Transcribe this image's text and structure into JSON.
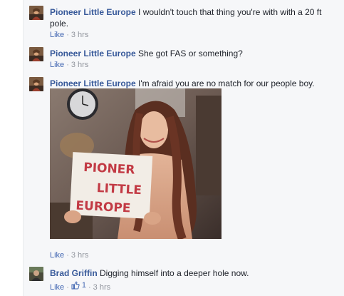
{
  "comments": [
    {
      "author": "Pioneer Little Europe",
      "text": "I wouldn't touch that thing you're with with a 20 ft pole.",
      "like_label": "Like",
      "time": "3 hrs"
    },
    {
      "author": "Pioneer Little Europe",
      "text": "She got FAS or something?",
      "like_label": "Like",
      "time": "3 hrs"
    },
    {
      "author": "Pioneer Little Europe",
      "text": "I'm afraid you are no match for our people boy.",
      "like_label": "Like",
      "time": "3 hrs",
      "photo_sign": {
        "line1": "PIONER",
        "line2": "LITTLE",
        "line3": "EUROPE"
      }
    },
    {
      "author": "Brad Griffin",
      "text": "Digging himself into a deeper hole now.",
      "like_label": "Like",
      "like_count": "1",
      "time": "3 hrs"
    }
  ],
  "separator": "·",
  "icons": {
    "avatar_ple": "avatar-pioneer-little-europe",
    "avatar_bg": "avatar-brad-griffin",
    "like_count": "thumbs-up-icon"
  },
  "colors": {
    "author_link": "#365899",
    "action_link": "#4267b2",
    "meta_gray": "#90949c",
    "thread_bg": "#f6f7f9"
  }
}
